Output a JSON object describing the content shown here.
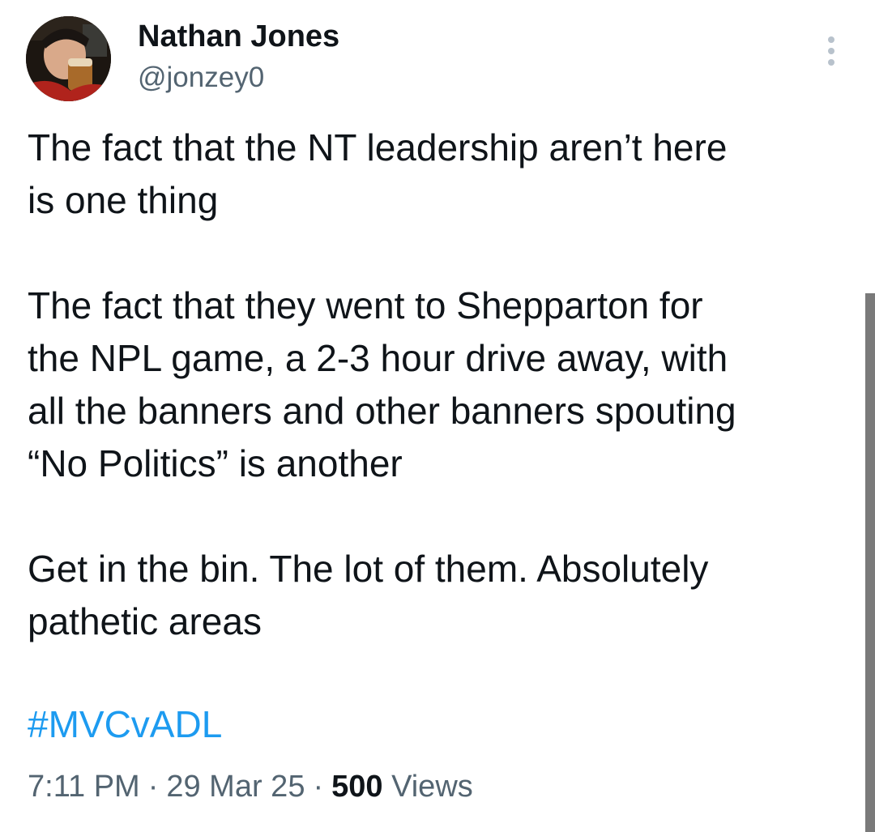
{
  "author": {
    "display_name": "Nathan Jones",
    "handle": "@jonzey0"
  },
  "more_menu_icon": "more-vertical-icon",
  "tweet": {
    "paragraphs": [
      "The fact that the NT leadership aren’t here\nis one thing",
      "The fact that they went to Shepparton for\nthe NPL game, a 2-3 hour drive away, with\nall the banners and other banners spouting\n“No Politics” is another",
      "Get in the bin. The lot of them. Absolutely\npathetic areas"
    ],
    "hashtag": "#MVCvADL"
  },
  "meta": {
    "time": "7:11 PM",
    "date": "29 Mar 25",
    "views_count": "500",
    "views_label": "Views",
    "separator": "·"
  },
  "colors": {
    "text": "#0f1419",
    "secondary": "#536471",
    "link": "#1d9bf0"
  }
}
